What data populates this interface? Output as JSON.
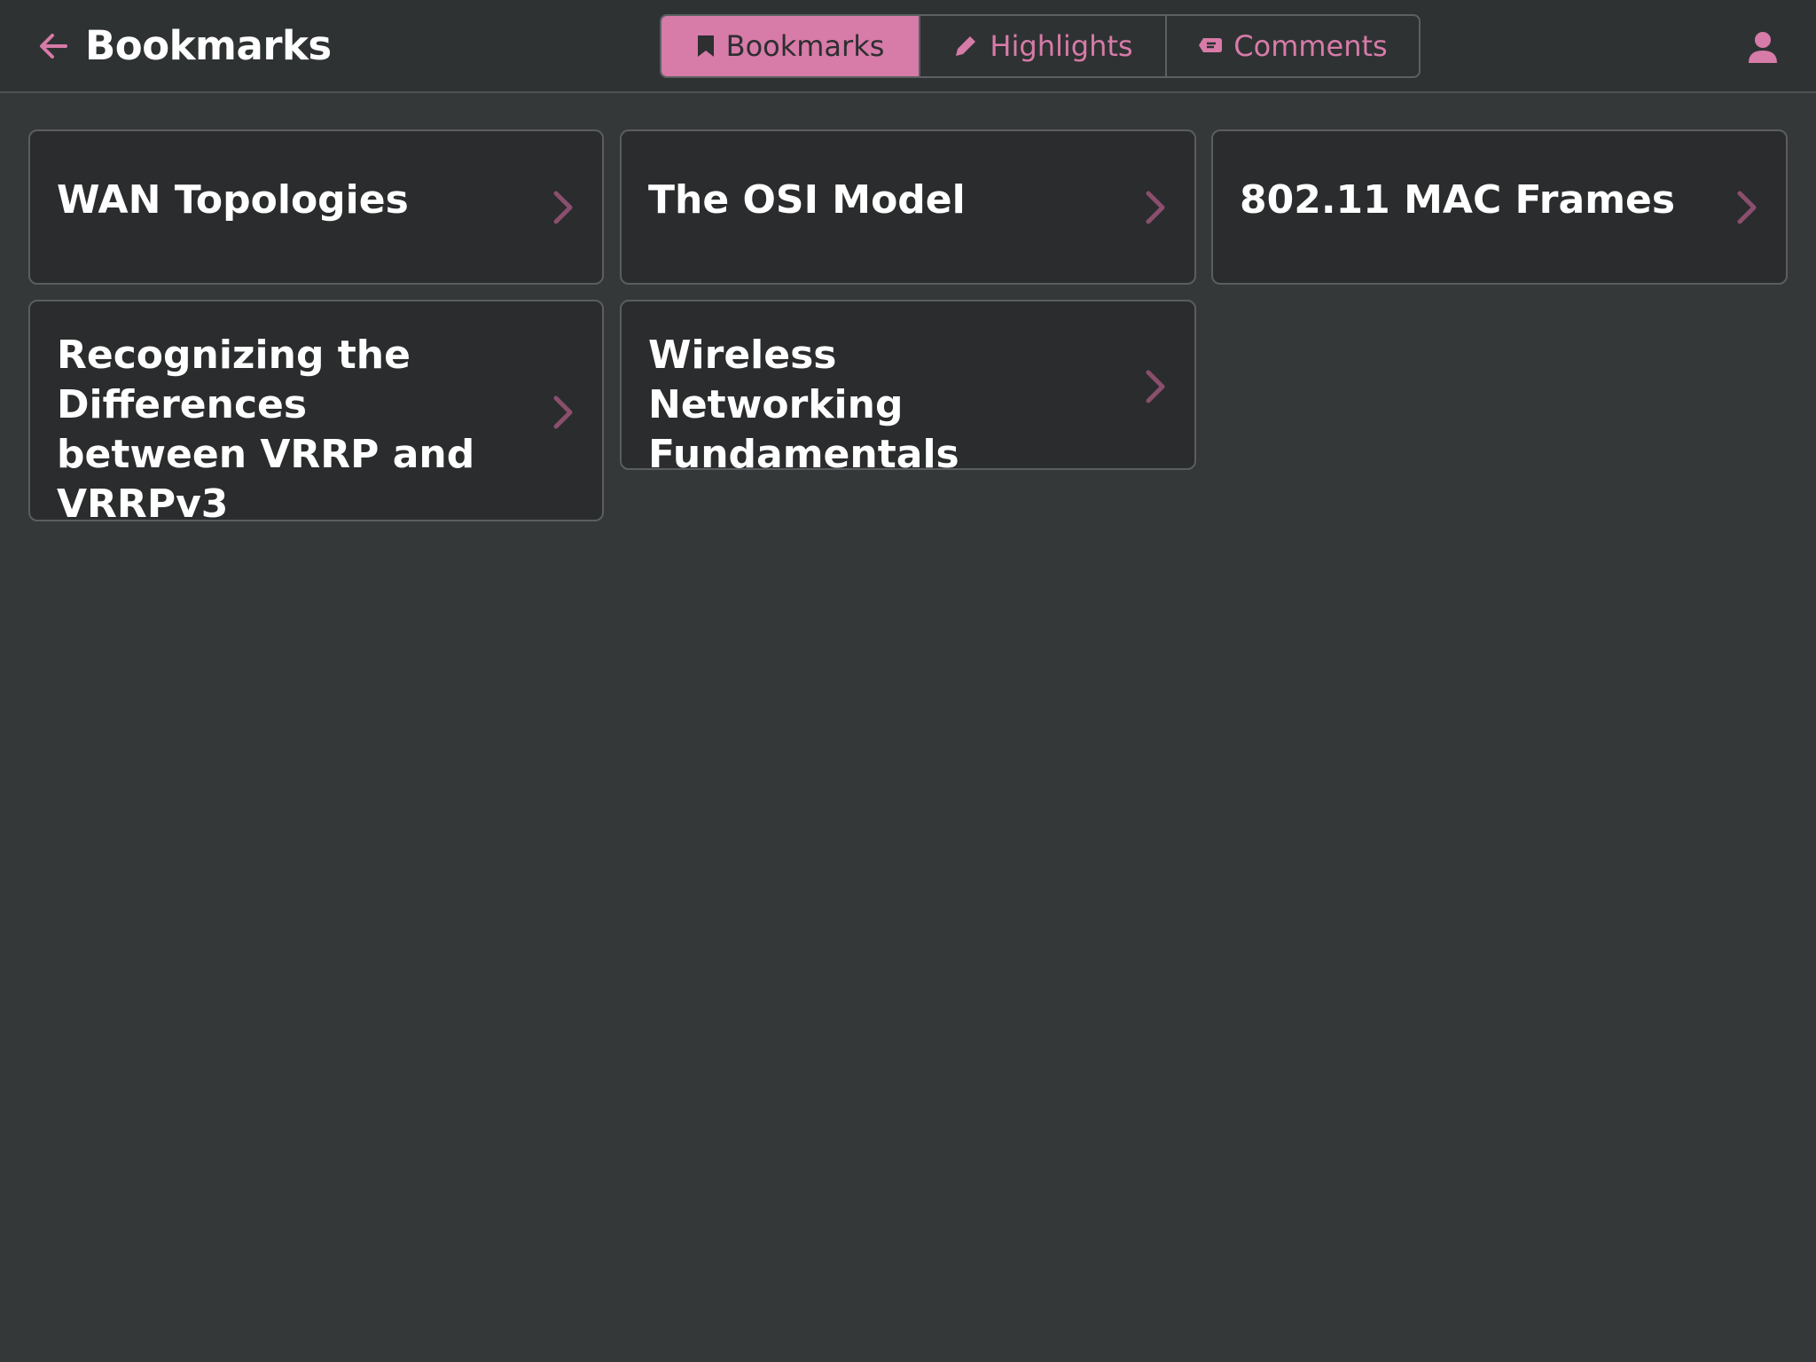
{
  "header": {
    "title": "Bookmarks",
    "back_icon": "arrow-left-icon",
    "user_icon": "user-icon",
    "accent_color": "#d77ba8"
  },
  "tabs": [
    {
      "label": "Bookmarks",
      "icon": "bookmark-icon",
      "active": true
    },
    {
      "label": "Highlights",
      "icon": "pencil-icon",
      "active": false
    },
    {
      "label": "Comments",
      "icon": "comment-icon",
      "active": false
    }
  ],
  "bookmarks": [
    {
      "title": "WAN Topologies"
    },
    {
      "title": "The OSI Model"
    },
    {
      "title": "802.11 MAC Frames"
    },
    {
      "title": "Recognizing the Differences between VRRP and VRRPv3"
    },
    {
      "title": "Wireless Networking Fundamentals"
    }
  ]
}
